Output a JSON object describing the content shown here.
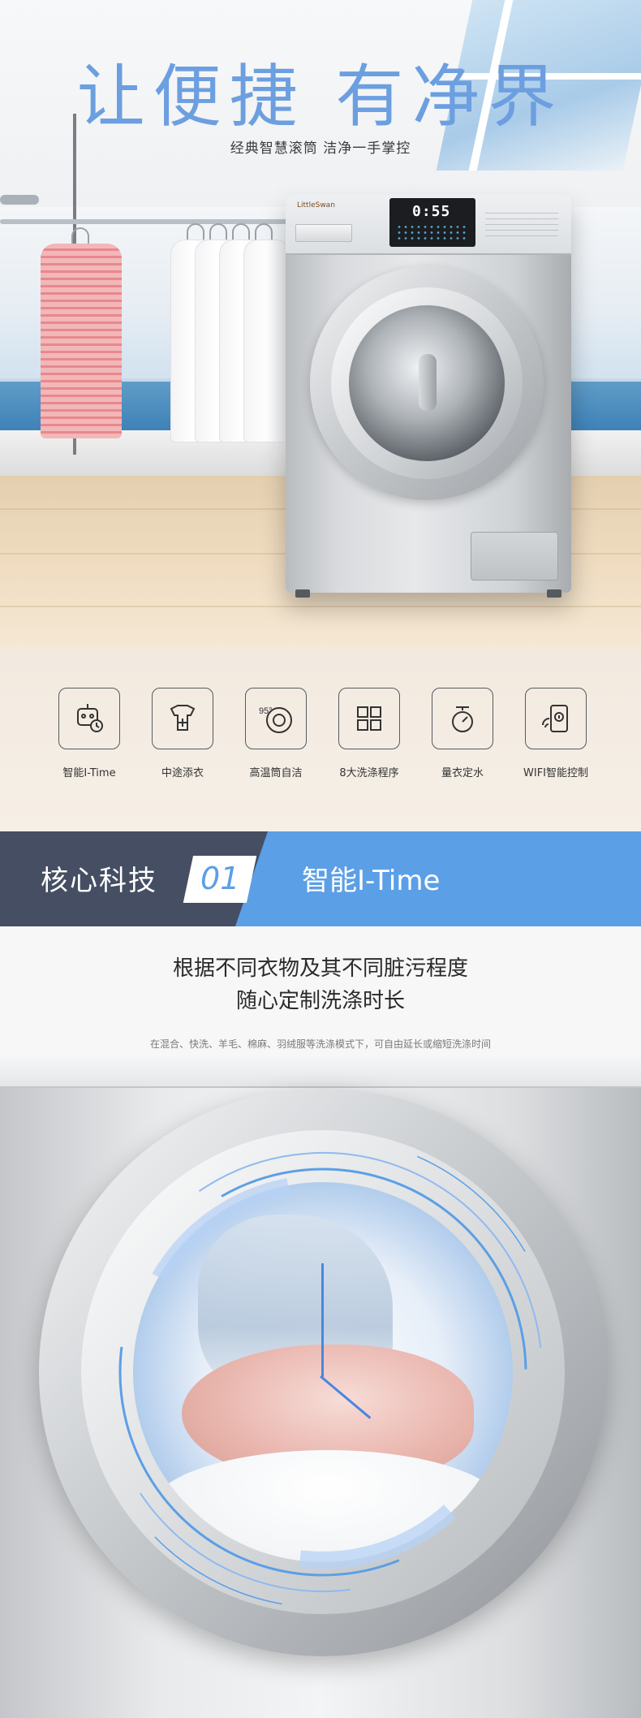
{
  "hero": {
    "headline": "让便捷 有净界",
    "subline": "经典智慧滚筒   洁净一手掌控",
    "brand": "LittleSwan",
    "panel_display": "0:55"
  },
  "features": [
    {
      "label": "智能I-Time",
      "icon": "robot-timer-icon"
    },
    {
      "label": "中途添衣",
      "icon": "add-clothes-icon"
    },
    {
      "label": "高温筒自洁",
      "icon": "drum-95-icon"
    },
    {
      "label": "8大洗涤程序",
      "icon": "program-grid-icon"
    },
    {
      "label": "量衣定水",
      "icon": "scale-icon"
    },
    {
      "label": "WIFI智能控制",
      "icon": "phone-wifi-icon"
    }
  ],
  "core": {
    "title": "核心科技",
    "number": "01",
    "feature": "智能I-Time"
  },
  "description": {
    "line1": "根据不同衣物及其不同脏污程度",
    "line2": "随心定制洗涤时长",
    "small": "在混合、快洗、羊毛、棉麻、羽绒服等洗涤模式下，可自由延长或缩短洗涤时间"
  },
  "colors": {
    "accent_blue": "#5b9fe6",
    "band_dark": "#464e63",
    "headline_blue": "#6c9fe0",
    "feature_bg": "#f2eadf"
  }
}
